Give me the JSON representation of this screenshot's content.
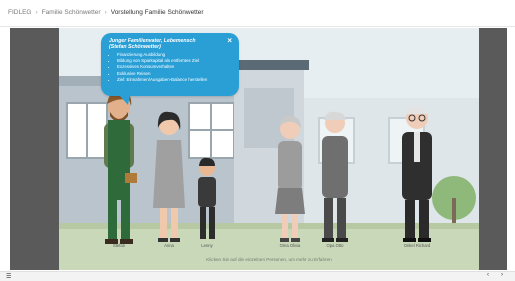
{
  "breadcrumb": {
    "items": [
      "FIDLEG",
      "Familie Schönwetter",
      "Vorstellung Familie Schönwetter"
    ],
    "separator": "›"
  },
  "bubble": {
    "title_line1": "Junger Familienvater, Lebemensch",
    "title_line2": "(Stefan Schönwetter)",
    "close": "×",
    "items": [
      "Finanzierung Ausbildung",
      "Bildung von Sparkapital als entferntes Ziel",
      "Exzessives Konsumverhalten",
      "Exklusive Reisen",
      "Ziel: Einnahmen/Ausgaben-Balance herstellen"
    ],
    "color": "#2a9fd6"
  },
  "persons": [
    {
      "name": "Stefan"
    },
    {
      "name": "Anna"
    },
    {
      "name": "Lenny"
    },
    {
      "name": "Oma Olivia"
    },
    {
      "name": "Opa Otto"
    },
    {
      "name": "Onkel Richard"
    }
  ],
  "hint": "Klicken Sie auf die einzelnen Personen, um mehr zu Erfahren",
  "nav": {
    "menu_icon": "menu-icon",
    "prev_icon": "chevron-left-icon",
    "next_icon": "chevron-right-icon"
  }
}
